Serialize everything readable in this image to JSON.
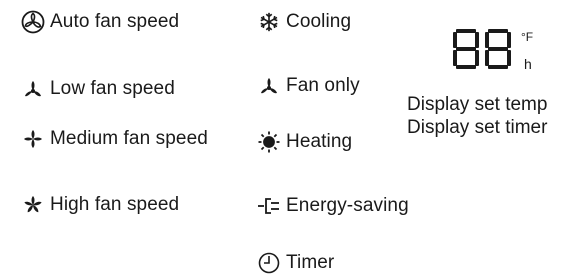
{
  "column_fan": [
    {
      "icon": "auto-fan-icon",
      "label": "Auto fan speed"
    },
    {
      "icon": "low-fan-icon",
      "label": "Low fan speed"
    },
    {
      "icon": "medium-fan-icon",
      "label": "Medium fan speed"
    },
    {
      "icon": "high-fan-icon",
      "label": "High fan speed"
    }
  ],
  "column_mode": [
    {
      "icon": "cooling-snowflake-icon",
      "label": "Cooling"
    },
    {
      "icon": "fan-only-icon",
      "label": "Fan only"
    },
    {
      "icon": "heating-sun-icon",
      "label": "Heating"
    },
    {
      "icon": "energy-saving-plug-icon",
      "label": "Energy-saving"
    },
    {
      "icon": "timer-clock-icon",
      "label": "Timer"
    }
  ],
  "display": {
    "digits": "88",
    "unit_temp": "°F",
    "unit_time": "h",
    "line1": "Display set temp",
    "line2": "Display set timer"
  }
}
